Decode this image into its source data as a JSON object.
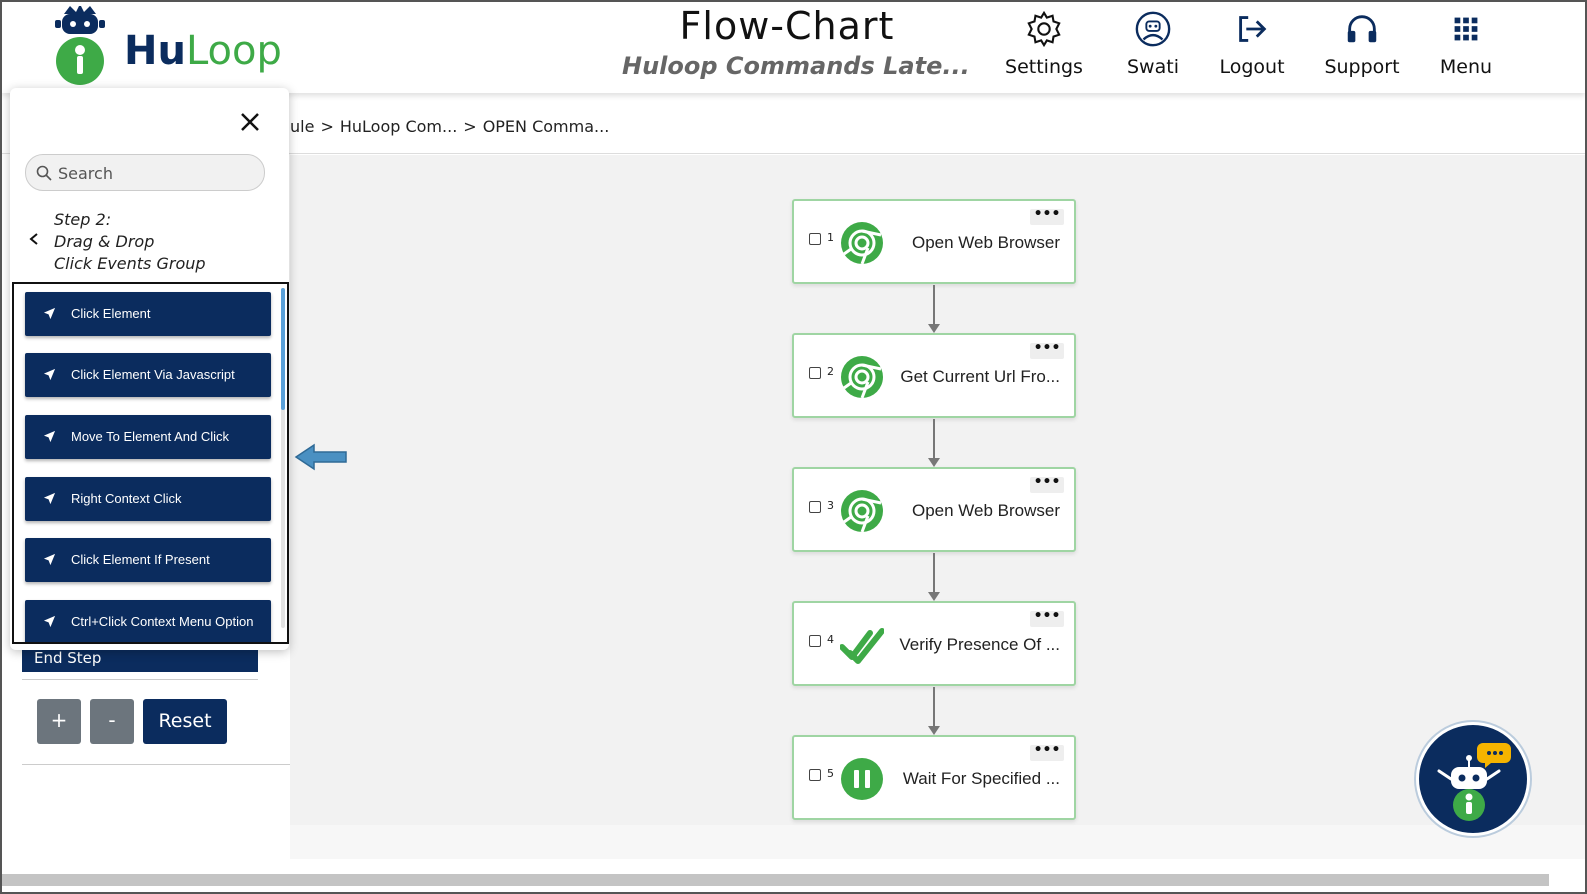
{
  "header": {
    "logo_hu": "Hu",
    "logo_loop": "Loop",
    "title": "Flow-Chart",
    "subtitle": "Huloop Commands Late...",
    "nav": [
      {
        "label": "Settings",
        "icon": "gear-icon"
      },
      {
        "label": "Swati",
        "icon": "user-robot-icon"
      },
      {
        "label": "Logout",
        "icon": "logout-icon"
      },
      {
        "label": "Support",
        "icon": "headphones-icon"
      },
      {
        "label": "Menu",
        "icon": "grid-menu-icon"
      }
    ]
  },
  "breadcrumb": {
    "items": [
      "ule",
      "HuLoop Com...",
      "OPEN Comma..."
    ],
    "separator": ">"
  },
  "panel": {
    "search_placeholder": "Search",
    "step_title": "Step 2:",
    "step_line2": "Drag & Drop",
    "step_line3": "Click Events Group",
    "commands": [
      "Click Element",
      "Click Element Via Javascript",
      "Move To Element And Click",
      "Right Context Click",
      "Click Element If Present",
      "Ctrl+Click Context Menu Option"
    ]
  },
  "left_controls": {
    "end_step": "End Step",
    "plus": "+",
    "minus": "-",
    "reset": "Reset"
  },
  "flow": {
    "menu_glyph": "•••",
    "nodes": [
      {
        "num": "1",
        "label": "Open Web Browser",
        "icon": "chrome-icon"
      },
      {
        "num": "2",
        "label": "Get Current Url Fro...",
        "icon": "chrome-icon"
      },
      {
        "num": "3",
        "label": "Open Web Browser",
        "icon": "chrome-icon"
      },
      {
        "num": "4",
        "label": "Verify Presence Of ...",
        "icon": "double-check-icon"
      },
      {
        "num": "5",
        "label": "Wait For Specified ...",
        "icon": "pause-icon"
      }
    ]
  },
  "colors": {
    "navy": "#0b2c5e",
    "green": "#3eaa47",
    "node_border": "#9fd5a3",
    "arrow_blue": "#4a90c2"
  }
}
